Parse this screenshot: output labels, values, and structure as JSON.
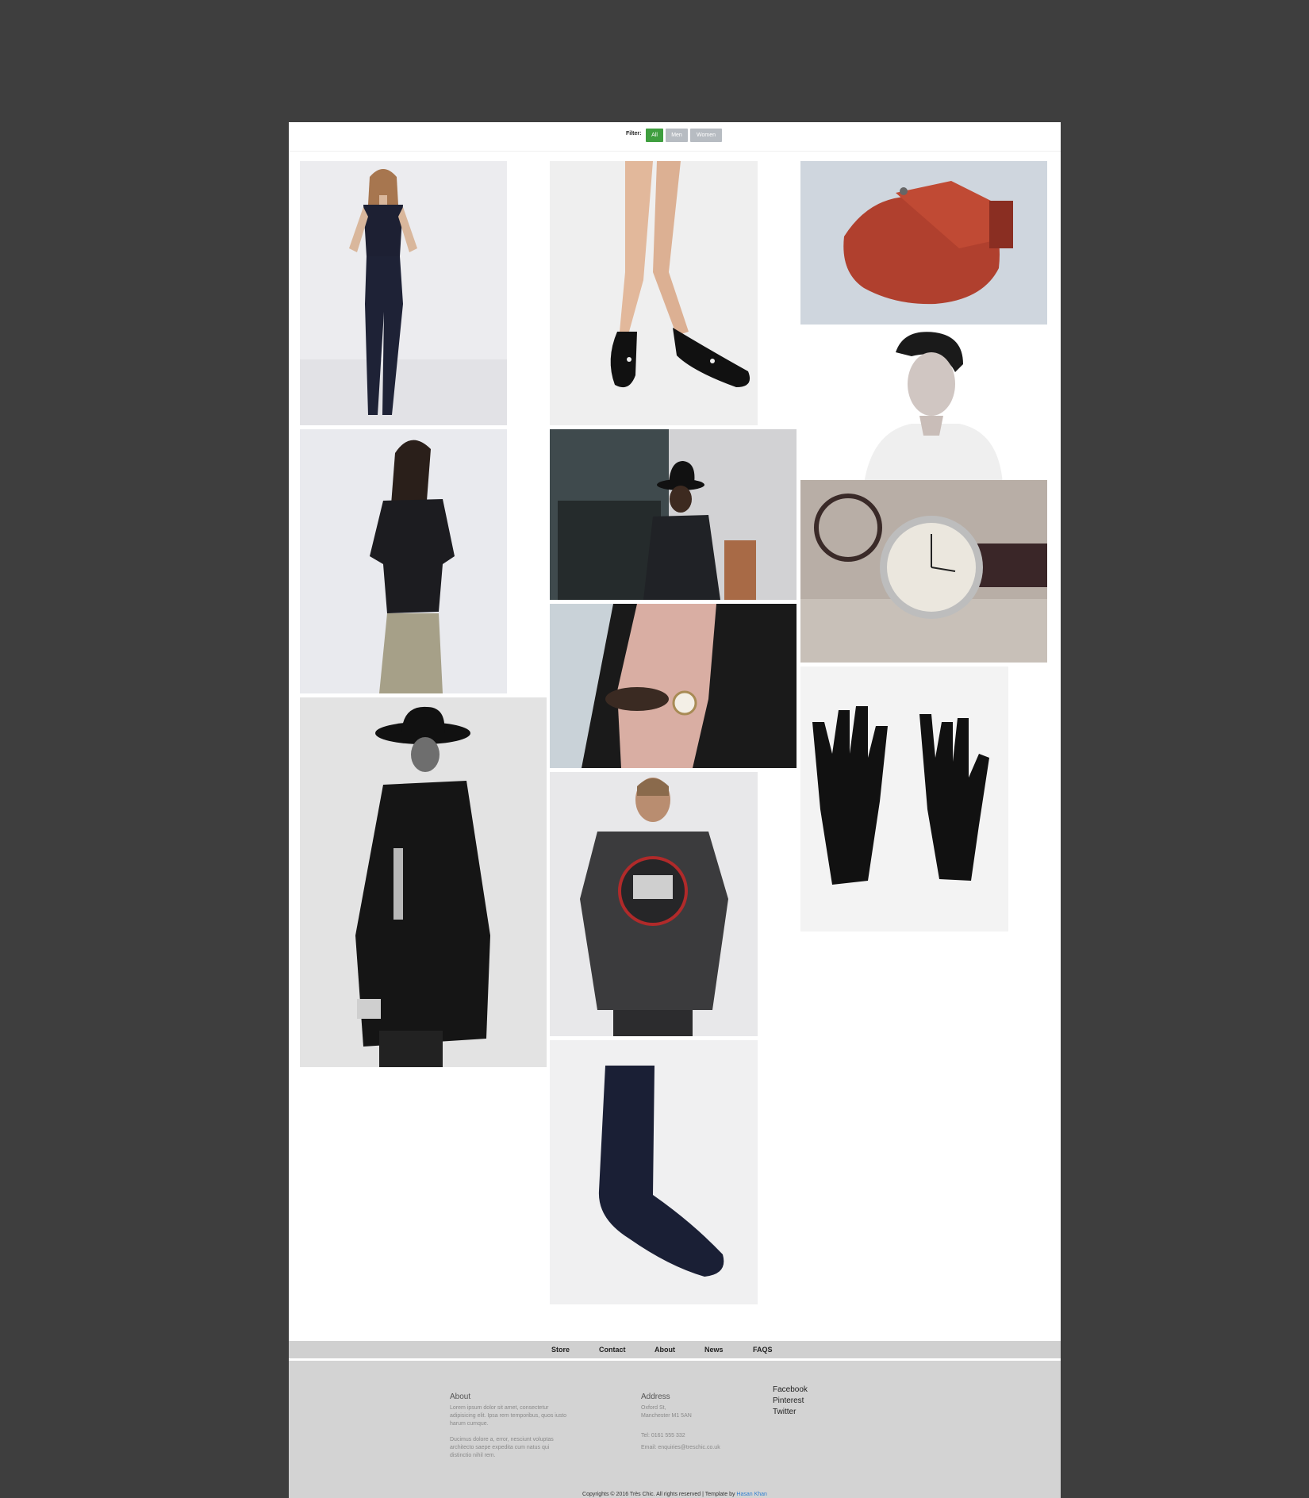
{
  "filter": {
    "label": "Filter:",
    "buttons": [
      "All",
      "Men",
      "Women"
    ],
    "active": "All"
  },
  "gallery": {
    "items": [
      {
        "subject": "woman in black jumpsuit",
        "category": "Women"
      },
      {
        "subject": "black pointed flat shoes",
        "category": "Women"
      },
      {
        "subject": "red leather gloves",
        "category": "Men"
      },
      {
        "subject": "man portrait black and white",
        "category": "Men"
      },
      {
        "subject": "woman in black satin top",
        "category": "Women"
      },
      {
        "subject": "man in black hat street",
        "category": "Men"
      },
      {
        "subject": "wristwatch with bicycle",
        "category": "Men"
      },
      {
        "subject": "leather jacket and pink blouse",
        "category": "Women"
      },
      {
        "subject": "man in hat and long black coat",
        "category": "Men"
      },
      {
        "subject": "man in Guns N' Roses sweatshirt",
        "category": "Men"
      },
      {
        "subject": "black knit gloves",
        "category": "Men"
      },
      {
        "subject": "navy sock",
        "category": "Men"
      }
    ]
  },
  "footer": {
    "nav": [
      "Store",
      "Contact",
      "About",
      "News",
      "FAQS"
    ],
    "about": {
      "title": "About",
      "p1_l1": "Lorem ipsum dolor sit amet, consectetur",
      "p1_l2": "adipisicing elit. Ipsa rem temporibus, quos iusto",
      "p1_l3": "harum cumque.",
      "p2_l1": "Ducimus dolore a, error, nesciunt voluptas",
      "p2_l2": "architecto saepe expedita cum natus qui",
      "p2_l3": "distinctio nihil rem."
    },
    "address": {
      "title": "Address",
      "line1": "Oxford St,",
      "line2": "Manchester M1 5AN",
      "tel": "Tel: 0161 555 332",
      "email": "Email: enquiries@treschic.co.uk"
    },
    "social": [
      "Facebook",
      "Pinterest",
      "Twitter"
    ],
    "copyright": {
      "text": "Copyrights © 2016 Très Chic. All rights reserved | Template by",
      "author": "Hasan Khan"
    }
  },
  "colors": {
    "background": "#3e3e3e",
    "page": "#ffffff",
    "filter_active": "#3f9e3f",
    "filter_inactive": "#b7bcc2",
    "footer": "#d3d3d3",
    "link": "#2f7fd1"
  }
}
